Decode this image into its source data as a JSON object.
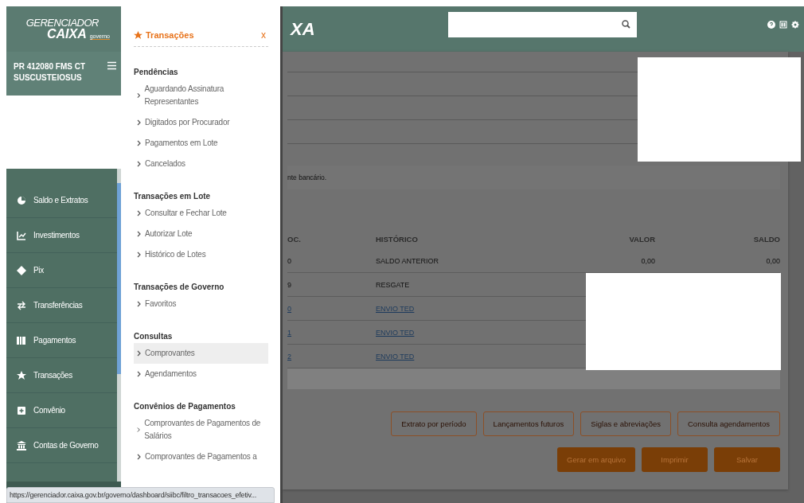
{
  "sidebar": {
    "logo": {
      "line_1": "GERENCIADOR",
      "line_2": "CAIXA",
      "tag": "governo"
    },
    "account": "PR 412080 FMS CT SUSCUSTEIOSUS",
    "nav": [
      {
        "label": "Saldo e Extratos"
      },
      {
        "label": "Investimentos"
      },
      {
        "label": "Pix"
      },
      {
        "label": "Transferências"
      },
      {
        "label": "Pagamentos"
      },
      {
        "label": "Transações"
      },
      {
        "label": "Convênio"
      },
      {
        "label": "Contas de Governo"
      }
    ]
  },
  "flyout": {
    "title": "Transações",
    "close": "x",
    "sections": [
      {
        "heading": "Pendências",
        "items": [
          {
            "label": "Aguardando Assinatura Representantes",
            "selected": false
          },
          {
            "label": "Digitados por Procurador",
            "selected": false
          },
          {
            "label": "Pagamentos em Lote",
            "selected": false
          },
          {
            "label": "Cancelados",
            "selected": false
          }
        ]
      },
      {
        "heading": "Transações em Lote",
        "items": [
          {
            "label": "Consultar e Fechar Lote",
            "selected": false
          },
          {
            "label": "Autorizar Lote",
            "selected": false
          },
          {
            "label": "Histórico de Lotes",
            "selected": false
          }
        ]
      },
      {
        "heading": "Transações de Governo",
        "items": [
          {
            "label": "Favoritos",
            "selected": false
          }
        ]
      },
      {
        "heading": "Consultas",
        "items": [
          {
            "label": "Comprovantes",
            "selected": true
          },
          {
            "label": "Agendamentos",
            "selected": false
          }
        ]
      },
      {
        "heading": "Convênios de Pagamentos",
        "items": [
          {
            "label": "Comprovantes de Pagamentos de Salários",
            "selected": false
          },
          {
            "label": "Comprovantes de Pagamentos a",
            "selected": false
          }
        ]
      }
    ]
  },
  "main": {
    "logo_fragment": "XA",
    "notice": "nte bancário.",
    "table": {
      "columns": [
        "OC.",
        "HISTÓRICO",
        "VALOR",
        "SALDO"
      ],
      "rows": [
        {
          "kind": "plain",
          "cells": [
            "0",
            "SALDO ANTERIOR",
            "0,00",
            "0,00"
          ]
        },
        {
          "kind": "plain",
          "cells": [
            "9",
            "RESGATE"
          ]
        },
        {
          "kind": "link",
          "cells": [
            "0",
            "ENVIO TED"
          ]
        },
        {
          "kind": "link",
          "cells": [
            "1",
            "ENVIO TED"
          ]
        },
        {
          "kind": "link",
          "cells": [
            "2",
            "ENVIO TED"
          ]
        }
      ]
    },
    "link_buttons": [
      "Extrato por período",
      "Lançamentos futuros",
      "Siglas e abreviações",
      "Consulta agendamentos"
    ],
    "action_buttons": [
      "Gerar em arquivo",
      "Imprimir",
      "Salvar"
    ]
  },
  "status_url": "https://gerenciador.caixa.gov.br/governo/dashboard/siibc/filtro_transacoes_efetiv..."
}
